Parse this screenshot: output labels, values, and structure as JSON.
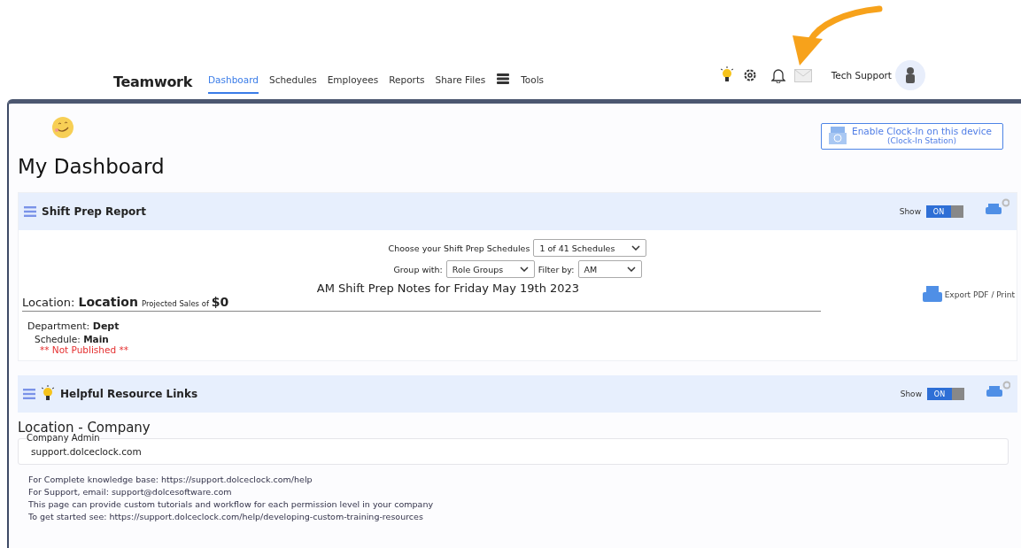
{
  "nav": {
    "logo": "Teamwork",
    "items": [
      {
        "label": "Dashboard",
        "selected": true
      },
      {
        "label": "Schedules",
        "selected": false
      },
      {
        "label": "Employees",
        "selected": false
      },
      {
        "label": "Reports",
        "selected": false
      },
      {
        "label": "Share Files",
        "selected": false
      },
      {
        "label": "Tools",
        "selected": false
      }
    ],
    "user": "Tech Support"
  },
  "clock_in": {
    "label": "Enable Clock-In on this device",
    "sub": "(Clock-In Station)"
  },
  "page_title": "My Dashboard",
  "shift_prep": {
    "title": "Shift Prep Report",
    "show_label": "Show",
    "toggle_label": "ON",
    "on": true,
    "schedules_label": "Choose your Shift Prep Schedules",
    "schedules_value": "1 of 41 Schedules",
    "group_label": "Group with:",
    "group_value": "Role Groups",
    "filter_label": "Filter by:",
    "filter_value": "AM",
    "notes_title": "AM Shift Prep Notes for Friday May 19th 2023",
    "export": "Export PDF / Print",
    "location_label": "Location:",
    "location": "Location",
    "sales_label": "Projected Sales of",
    "sales": "$0",
    "department_label": "Department:",
    "department": "Dept",
    "schedule_label": "Schedule:",
    "schedule": "Main",
    "status": "** Not Published **"
  },
  "resources": {
    "title": "Helpful Resource Links",
    "show_label": "Show",
    "toggle_label": "ON",
    "on": true,
    "heading": "Location - Company",
    "field_label": "Company Admin",
    "field_value": "support.dolceclock.com",
    "lines": [
      "For Complete knowledge base: https://support.dolceclock.com/help",
      "For Support, email: support@dolcesoftware.com",
      "This page can provide custom tutorials and workflow for each permission level in your company",
      "To get started see: https://support.dolceclock.com/help/developing-custom-training-resources"
    ]
  }
}
